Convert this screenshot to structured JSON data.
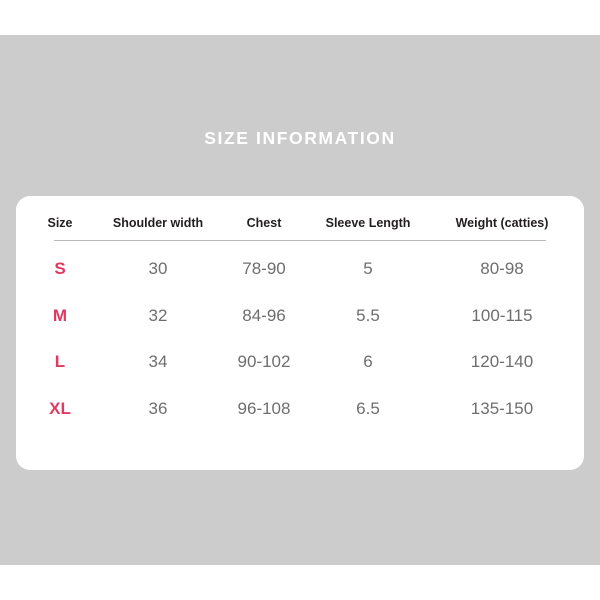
{
  "page": {
    "background_color": "#cdcccd",
    "card_color": "#ffffff"
  },
  "header": {
    "title": "SIZE INFORMATION",
    "title_color": "#ffffff"
  },
  "table": {
    "accent_color": "#e03a61",
    "value_color": "#6e6e6e",
    "header_color": "#231f20",
    "columns": [
      {
        "key": "size",
        "label": "Size"
      },
      {
        "key": "shoulder",
        "label": "Shoulder width"
      },
      {
        "key": "chest",
        "label": "Chest"
      },
      {
        "key": "sleeve",
        "label": "Sleeve Length"
      },
      {
        "key": "weight",
        "label": "Weight (catties)"
      }
    ],
    "rows": [
      {
        "size": "S",
        "shoulder": "30",
        "chest": "78-90",
        "sleeve": "5",
        "weight": "80-98"
      },
      {
        "size": "M",
        "shoulder": "32",
        "chest": "84-96",
        "sleeve": "5.5",
        "weight": "100-115"
      },
      {
        "size": "L",
        "shoulder": "34",
        "chest": "90-102",
        "sleeve": "6",
        "weight": "120-140"
      },
      {
        "size": "XL",
        "shoulder": "36",
        "chest": "96-108",
        "sleeve": "6.5",
        "weight": "135-150"
      }
    ]
  }
}
